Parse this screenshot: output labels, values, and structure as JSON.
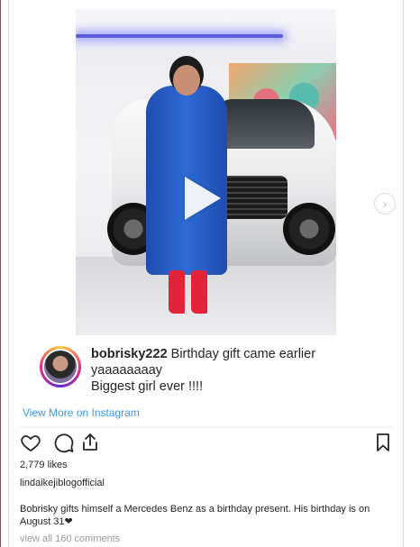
{
  "post": {
    "caption": {
      "username": "bobrisky222",
      "text_line1": " Birthday gift came earlier",
      "text_line2": "yaaaaaaaay",
      "text_line3": "Biggest girl ever !!!!"
    },
    "view_more_label": "View More on Instagram",
    "likes_text": "2,779 likes",
    "account_name": "lindaikejiblogofficial",
    "description": "Bobrisky gifts himself a Mercedes Benz as a birthday present. His birthday is on August 31❤",
    "comments_label": "view all 160 comments"
  },
  "icons": {
    "like": "heart-icon",
    "comment": "comment-bubble-icon",
    "share": "share-icon",
    "save": "bookmark-icon",
    "play": "play-icon",
    "next": "chevron-right-icon"
  },
  "colors": {
    "link": "#3897f0",
    "muted": "#999999",
    "text": "#262626"
  }
}
